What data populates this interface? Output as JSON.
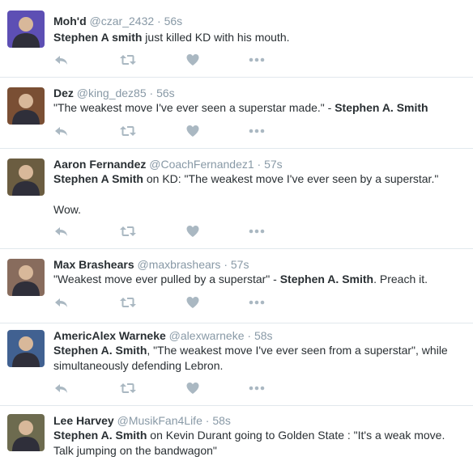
{
  "tweets": [
    {
      "name": "Moh'd",
      "handle": "@czar_2432",
      "time": "56s",
      "avatar_color": "#6a5acd",
      "segments": [
        {
          "t": "Stephen A smith",
          "b": true
        },
        {
          "t": " just killed KD with his mouth.",
          "b": false
        }
      ]
    },
    {
      "name": "Dez",
      "handle": "@king_dez85",
      "time": "56s",
      "avatar_color": "#8b5a3c",
      "segments": [
        {
          "t": "\"The weakest move I've ever seen a superstar made.\" - ",
          "b": false
        },
        {
          "t": "Stephen A. Smith",
          "b": true
        }
      ]
    },
    {
      "name": "Aaron Fernandez",
      "handle": "@CoachFernandez1",
      "time": "57s",
      "avatar_color": "#7a6a4a",
      "segments": [
        {
          "t": "Stephen A Smith",
          "b": true
        },
        {
          "t": " on KD: \"The weakest move I've ever seen by a superstar.\"\n\nWow.",
          "b": false
        }
      ]
    },
    {
      "name": "Max Brashears",
      "handle": "@maxbrashears",
      "time": "57s",
      "avatar_color": "#9b7b6a",
      "segments": [
        {
          "t": "\"Weakest move ever pulled by a superstar\" - ",
          "b": false
        },
        {
          "t": "Stephen A. Smith",
          "b": true
        },
        {
          "t": ". Preach it.",
          "b": false
        }
      ]
    },
    {
      "name": "AmericAlex Warneke",
      "handle": "@alexwarneke",
      "time": "58s",
      "avatar_color": "#4a6fa5",
      "segments": [
        {
          "t": "Stephen A. Smith",
          "b": true
        },
        {
          "t": ", \"The weakest move I've ever seen from a superstar\", while simultaneously defending Lebron.",
          "b": false
        }
      ]
    },
    {
      "name": "Lee Harvey",
      "handle": "@MusikFan4Life",
      "time": "58s",
      "avatar_color": "#7d7a5a",
      "segments": [
        {
          "t": "Stephen A. Smith",
          "b": true
        },
        {
          "t": " on Kevin Durant going to Golden State : \"It's a weak move. Talk jumping on the bandwagon\"",
          "b": false
        }
      ]
    }
  ],
  "separator": "·",
  "colors": {
    "text": "#292f33",
    "muted": "#8899a6",
    "icon": "#aab8c2",
    "border": "#e1e8ed"
  },
  "action_icons": [
    "reply-icon",
    "retweet-icon",
    "like-icon",
    "more-icon"
  ]
}
